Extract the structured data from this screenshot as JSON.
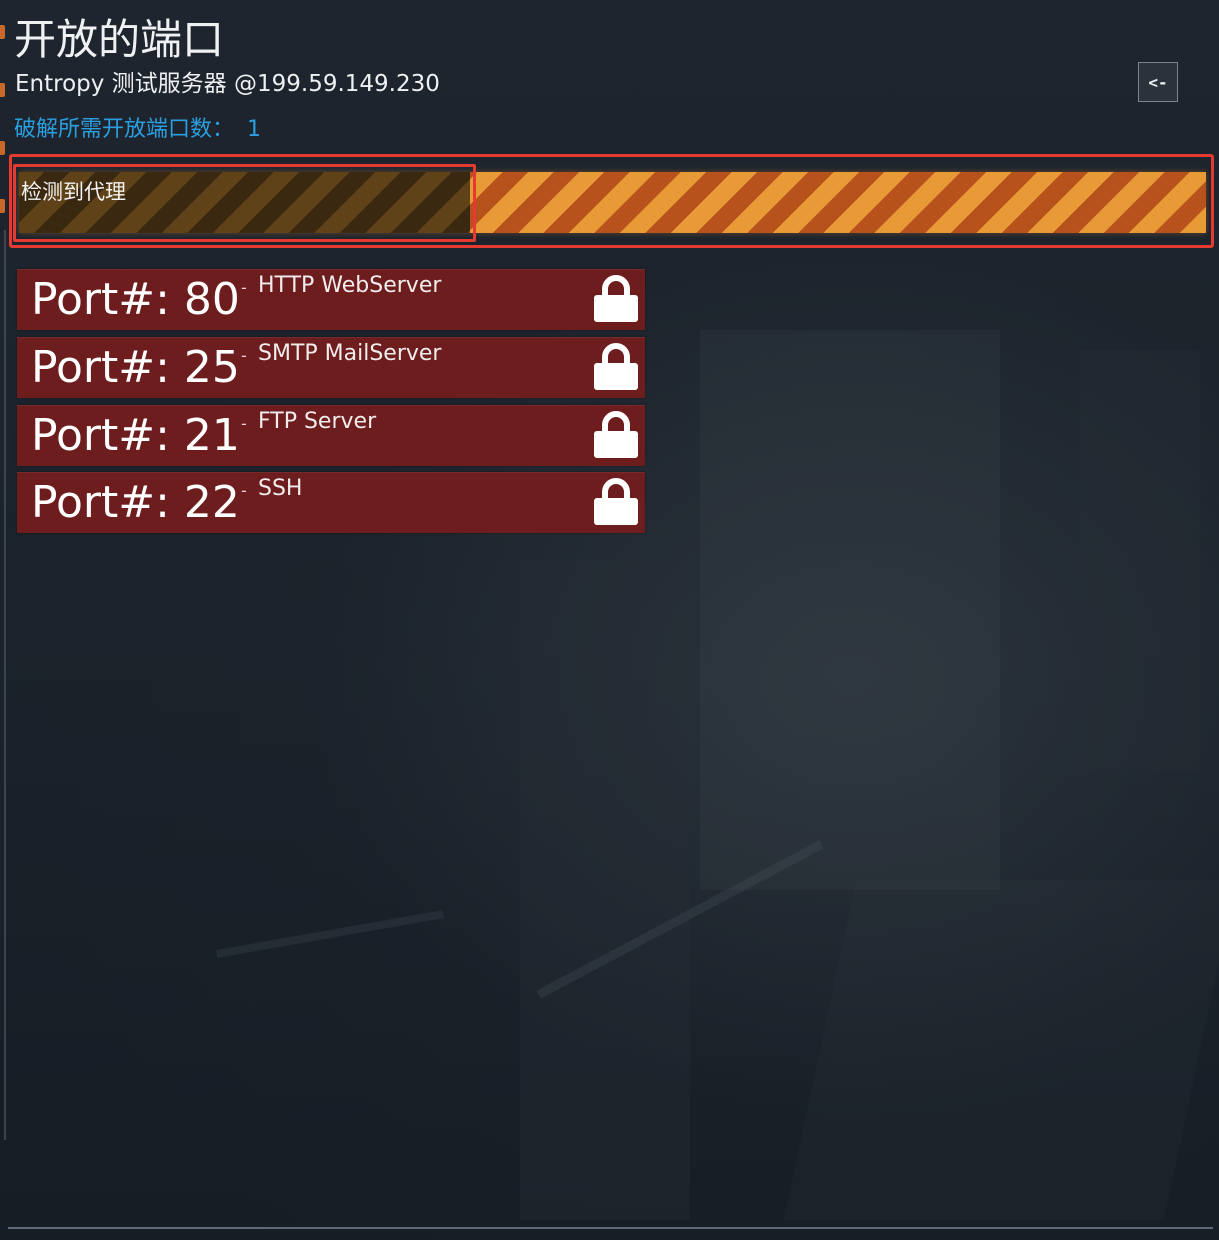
{
  "header": {
    "title": "开放的端口",
    "subtitle": "Entropy 测试服务器 @199.59.149.230",
    "required_label": "破解所需开放端口数：",
    "required_value": "1",
    "back_label": "<-"
  },
  "proxy": {
    "label": "检测到代理",
    "progress": 0.38,
    "colors": {
      "stripe_light": "#e89a36",
      "stripe_dark": "#b8521c",
      "highlight": "#e53a2f"
    }
  },
  "ports": [
    {
      "label": "Port#: 80",
      "separator": "-",
      "service": "HTTP WebServer",
      "icon": "lock-icon"
    },
    {
      "label": "Port#: 25",
      "separator": "-",
      "service": "SMTP MailServer",
      "icon": "lock-icon"
    },
    {
      "label": "Port#: 21",
      "separator": "-",
      "service": "FTP Server",
      "icon": "lock-icon"
    },
    {
      "label": "Port#: 22",
      "separator": "-",
      "service": "SSH",
      "icon": "lock-icon"
    }
  ],
  "colors": {
    "accent_blue": "#2a9fe0",
    "port_background": "#6e1d1f",
    "background": "#1b222b"
  }
}
